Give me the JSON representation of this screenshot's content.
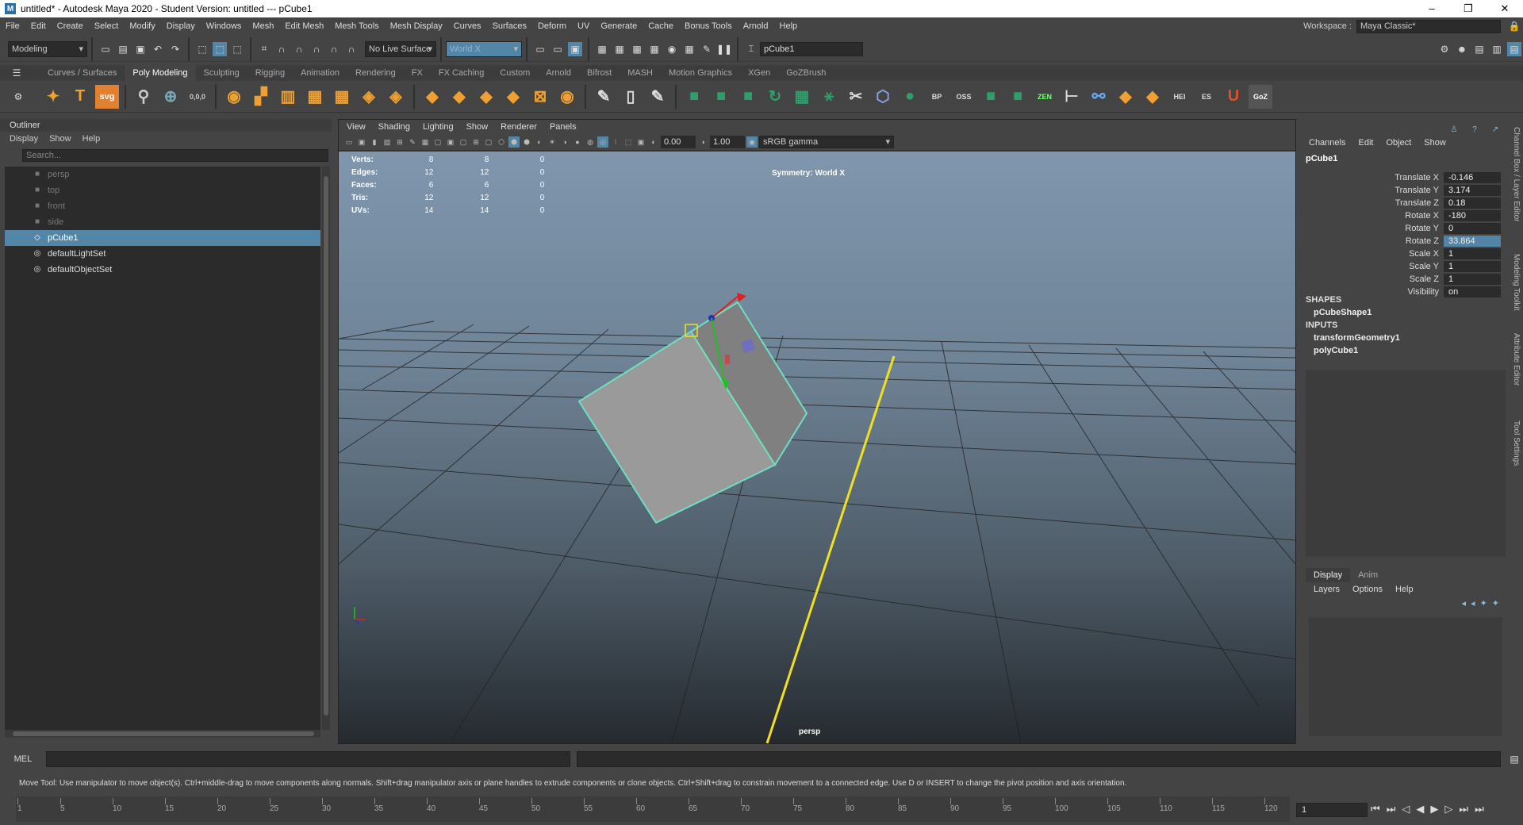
{
  "window": {
    "title": "untitled* - Autodesk Maya 2020 - Student Version: untitled   ---   pCube1",
    "app_icon": "M",
    "controls": [
      "–",
      "❐",
      "✕"
    ]
  },
  "menubar": {
    "items": [
      "File",
      "Edit",
      "Create",
      "Select",
      "Modify",
      "Display",
      "Windows",
      "Mesh",
      "Edit Mesh",
      "Mesh Tools",
      "Mesh Display",
      "Curves",
      "Surfaces",
      "Deform",
      "UV",
      "Generate",
      "Cache",
      "Bonus Tools",
      "Arnold",
      "Help"
    ],
    "workspace_label": "Workspace :",
    "workspace_value": "Maya Classic*"
  },
  "statusline": {
    "menuset": "Modeling",
    "live_surface": "No Live Surface",
    "symmetry": "World X",
    "object_name": "pCube1"
  },
  "shelf": {
    "tabs": [
      "Curves / Surfaces",
      "Poly Modeling",
      "Sculpting",
      "Rigging",
      "Animation",
      "Rendering",
      "FX",
      "FX Caching",
      "Custom",
      "Arnold",
      "Bifrost",
      "MASH",
      "Motion Graphics",
      "XGen",
      "GoZBrush"
    ],
    "active_tab": "Poly Modeling",
    "text_icons": {
      "t": "T",
      "svg": "svg",
      "bp": "BP",
      "oss": "OSS",
      "zen": "ZEN",
      "hei": "HEI",
      "es": "ES",
      "goz": "GoZ",
      "coords": "0,0,0"
    }
  },
  "outliner": {
    "title": "Outliner",
    "menu": [
      "Display",
      "Show",
      "Help"
    ],
    "search_placeholder": "Search...",
    "items": [
      {
        "label": "persp",
        "icon": "camera-icon",
        "dim": true
      },
      {
        "label": "top",
        "icon": "camera-icon",
        "dim": true
      },
      {
        "label": "front",
        "icon": "camera-icon",
        "dim": true
      },
      {
        "label": "side",
        "icon": "camera-icon",
        "dim": true
      },
      {
        "label": "pCube1",
        "icon": "mesh-icon",
        "selected": true
      },
      {
        "label": "defaultLightSet",
        "icon": "set-icon"
      },
      {
        "label": "defaultObjectSet",
        "icon": "set-icon"
      }
    ]
  },
  "viewport": {
    "menu": [
      "View",
      "Shading",
      "Lighting",
      "Show",
      "Renderer",
      "Panels"
    ],
    "exposure": "0.00",
    "gamma": "1.00",
    "colorspace": "sRGB gamma",
    "hud": [
      {
        "label": "Verts:",
        "a": "8",
        "b": "8",
        "c": "0"
      },
      {
        "label": "Edges:",
        "a": "12",
        "b": "12",
        "c": "0"
      },
      {
        "label": "Faces:",
        "a": "6",
        "b": "6",
        "c": "0"
      },
      {
        "label": "Tris:",
        "a": "12",
        "b": "12",
        "c": "0"
      },
      {
        "label": "UVs:",
        "a": "14",
        "b": "14",
        "c": "0"
      }
    ],
    "symmetry_label": "Symmetry: World X",
    "camera": "persp"
  },
  "channelbox": {
    "menu": [
      "Channels",
      "Edit",
      "Object",
      "Show"
    ],
    "object": "pCube1",
    "attributes": [
      {
        "name": "Translate X",
        "value": "-0.146"
      },
      {
        "name": "Translate Y",
        "value": "3.174"
      },
      {
        "name": "Translate Z",
        "value": "0.18"
      },
      {
        "name": "Rotate X",
        "value": "-180"
      },
      {
        "name": "Rotate Y",
        "value": "0"
      },
      {
        "name": "Rotate Z",
        "value": "33.864",
        "highlight": true
      },
      {
        "name": "Scale X",
        "value": "1"
      },
      {
        "name": "Scale Y",
        "value": "1"
      },
      {
        "name": "Scale Z",
        "value": "1"
      },
      {
        "name": "Visibility",
        "value": "on"
      }
    ],
    "shapes_label": "SHAPES",
    "shape": "pCubeShape1",
    "inputs_label": "INPUTS",
    "inputs": [
      "transformGeometry1",
      "polyCube1"
    ]
  },
  "layer_editor": {
    "tabs": [
      "Display",
      "Anim"
    ],
    "menu": [
      "Layers",
      "Options",
      "Help"
    ]
  },
  "side_tabs": [
    "Channel Box / Layer Editor",
    "Modeling Toolkit",
    "Attribute Editor",
    "Tool Settings"
  ],
  "command_line": {
    "label": "MEL"
  },
  "help_line": "Move Tool: Use manipulator to move object(s). Ctrl+middle-drag to move components along normals. Shift+drag manipulator axis or plane handles to extrude components or clone objects. Ctrl+Shift+drag to constrain movement to a connected edge. Use D or INSERT to change the pivot position and axis orientation.",
  "timeline": {
    "ticks": [
      "1",
      "5",
      "10",
      "15",
      "20",
      "25",
      "30",
      "35",
      "40",
      "45",
      "50",
      "55",
      "60",
      "65",
      "70",
      "75",
      "80",
      "85",
      "90",
      "95",
      "100",
      "105",
      "110",
      "115",
      "120"
    ],
    "current_frame": "1"
  },
  "colors": {
    "selection": "#5285a6",
    "wireframe_highlight": "#6de0c0",
    "grid_axis": "#f0e020"
  }
}
